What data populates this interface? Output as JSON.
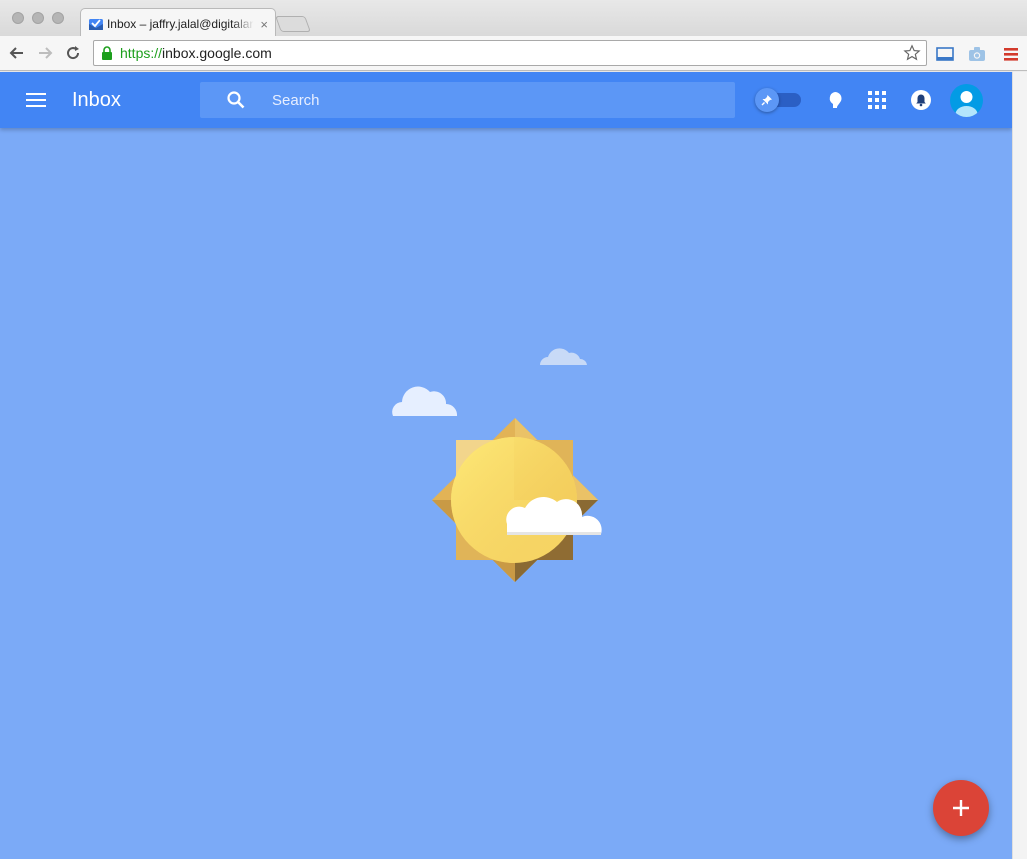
{
  "browser": {
    "tab": {
      "title": "Inbox – jaffry.jalal@digitalar",
      "close_glyph": "×",
      "favicon": "inbox-favicon-icon"
    },
    "new_tab_icon": "new-tab-icon",
    "omnibox": {
      "scheme": "https://",
      "host": "inbox.google.com",
      "lock_icon": "lock-icon",
      "star_icon": "star-icon"
    },
    "nav_icons": [
      "back-arrow-icon",
      "forward-arrow-icon",
      "reload-icon"
    ],
    "extension_icons": [
      "cast-icon",
      "camera-icon",
      "menu-icon"
    ]
  },
  "app": {
    "title": "Inbox",
    "search": {
      "placeholder": "Search"
    },
    "icons": [
      "menu-icon",
      "search-icon",
      "pin-icon",
      "reminder-icon",
      "apps-grid-icon",
      "notifications-icon",
      "account-avatar-icon",
      "compose-plus-icon"
    ],
    "colors": {
      "appbar": "#4285f4",
      "background": "#7baaf7",
      "search": "#5c97f6",
      "fab": "#db4437",
      "sun": "#f7d767",
      "sun_rays": "#e0b458"
    },
    "fab": {
      "label": "+"
    }
  }
}
